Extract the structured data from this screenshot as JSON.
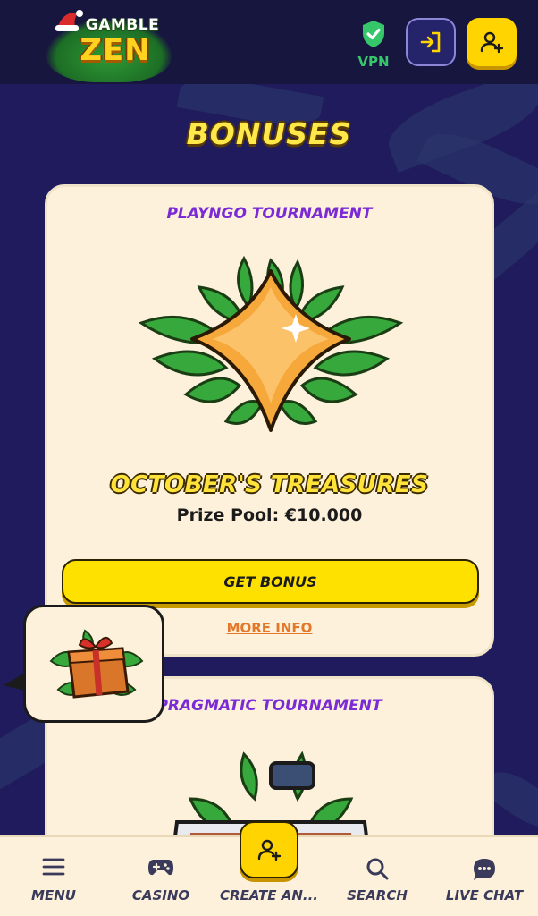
{
  "header": {
    "logo_top": "GAMBLE",
    "logo_bottom": "ZEN",
    "vpn_label": "VPN"
  },
  "page": {
    "title": "BONUSES"
  },
  "cards": [
    {
      "provider": "PLAYNGO TOURNAMENT",
      "name": "OCTOBER'S TREASURES",
      "prize": "Prize Pool: €10.000",
      "cta": "GET BONUS",
      "more": "MORE INFO"
    },
    {
      "provider": "PRAGMATIC TOURNAMENT"
    }
  ],
  "nav": {
    "menu": "MENU",
    "casino": "CASINO",
    "create": "CREATE AN...",
    "search": "SEARCH",
    "chat": "LIVE CHAT"
  },
  "colors": {
    "background": "#1f1b5c",
    "header": "#17163f",
    "card": "#fdf1db",
    "accent_yellow": "#ffe100",
    "provider_purple": "#7a2bd6",
    "link_orange": "#e3782a",
    "vpn_green": "#35c76a"
  },
  "icons": [
    "vpn-shield-icon",
    "login-icon",
    "add-user-icon",
    "menu-icon",
    "gamepad-icon",
    "search-icon",
    "chat-icon",
    "gift-icon"
  ]
}
